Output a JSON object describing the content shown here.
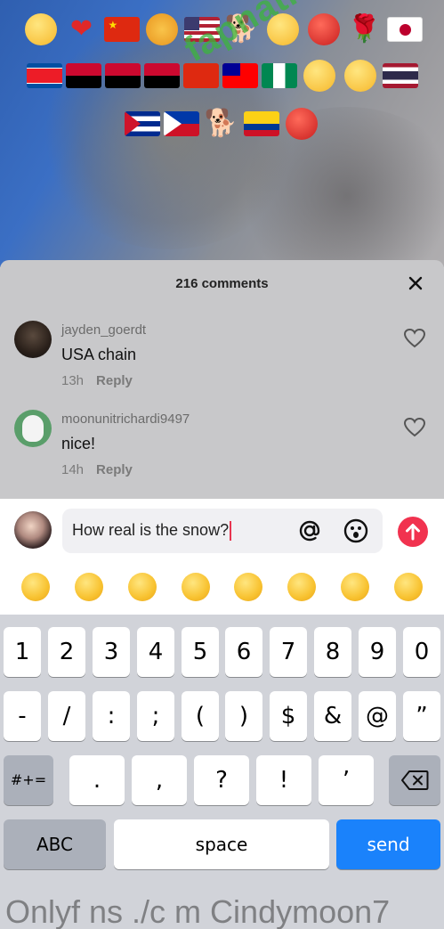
{
  "overlay": {
    "watermark": "fapnation.com",
    "emoji_rows": [
      [
        "smiling-face-hearts",
        "red-heart",
        "flag-china",
        "tiger-face",
        "flag-usa",
        "dog",
        "heart-eyes",
        "red-apple",
        "rose",
        "flag-japan"
      ],
      [
        "flag-north-korea",
        "flag-angola",
        "flag-angola",
        "flag-angola",
        "flag-hong-kong",
        "flag-taiwan",
        "flag-nigeria",
        "pleading-face",
        "rofl-face",
        "flag-thailand"
      ],
      [
        "flag-cuba",
        "flag-philippines",
        "dog",
        "flag-colombia",
        "red-apple"
      ]
    ]
  },
  "comments_sheet": {
    "title": "216 comments",
    "close_icon": "close-icon",
    "comments": [
      {
        "username": "jayden_goerdt",
        "text": "USA chain",
        "time": "13h",
        "reply_label": "Reply"
      },
      {
        "username": "moonunitrichardi9497",
        "text": "nice!",
        "time": "14h",
        "reply_label": "Reply"
      }
    ]
  },
  "composer": {
    "value": "How real is the snow?",
    "mention_icon": "at-icon",
    "emoji_icon": "smile-icon",
    "send_icon": "arrow-up-icon",
    "accent": "#f1324f"
  },
  "quick_emojis": [
    "grinning-face",
    "smiling-face-hearts",
    "tears-of-joy",
    "flushed-face",
    "smirking-face",
    "sweat-smile",
    "pleading-face",
    "relieved-face"
  ],
  "keyboard": {
    "row1": [
      "1",
      "2",
      "3",
      "4",
      "5",
      "6",
      "7",
      "8",
      "9",
      "0"
    ],
    "row2": [
      "-",
      "/",
      ":",
      ";",
      "(",
      ")",
      "$",
      "&",
      "@",
      "”"
    ],
    "row3_left": "#+=",
    "row3": [
      ".",
      ",",
      "?",
      "!",
      "’"
    ],
    "abc_label": "ABC",
    "space_label": "space",
    "send_label": "send",
    "send_color": "#1a82fb"
  },
  "footer_watermark": "Onlyf ns ./c m Cindymoon7"
}
